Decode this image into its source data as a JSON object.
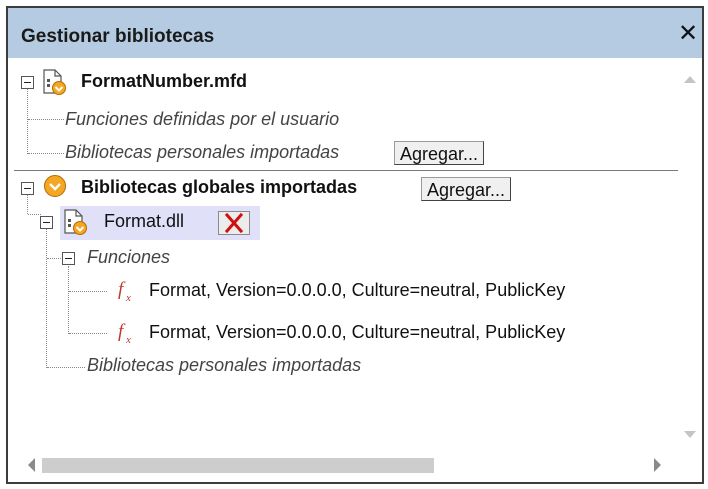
{
  "window": {
    "title": "Gestionar bibliotecas",
    "close_glyph": "✕"
  },
  "tree": {
    "mapping_file": {
      "name": "FormatNumber.mfd",
      "user_functions_label": "Funciones definidas por el usuario",
      "imported_label": "Bibliotecas personales importadas",
      "add_label": "Agregar..."
    },
    "global": {
      "label": "Bibliotecas globales importadas",
      "add_label": "Agregar...",
      "library": {
        "name": "Format.dll",
        "functions_label": "Funciones",
        "functions": [
          "Format, Version=0.0.0.0, Culture=neutral, PublicKey",
          "Format, Version=0.0.0.0, Culture=neutral, PublicKey"
        ],
        "imported_label": "Bibliotecas personales importadas"
      }
    }
  },
  "icons": {
    "mapping": "mapping-file-icon",
    "global": "global-library-icon",
    "dll": "dll-library-icon",
    "function": "function-icon",
    "delete": "delete-icon"
  },
  "colors": {
    "title_bar": "#b5cbe2",
    "selection": "#e0e0f8",
    "icon_orange": "#f5a623",
    "delete_red": "#d01010",
    "function_red": "#c0392b"
  }
}
